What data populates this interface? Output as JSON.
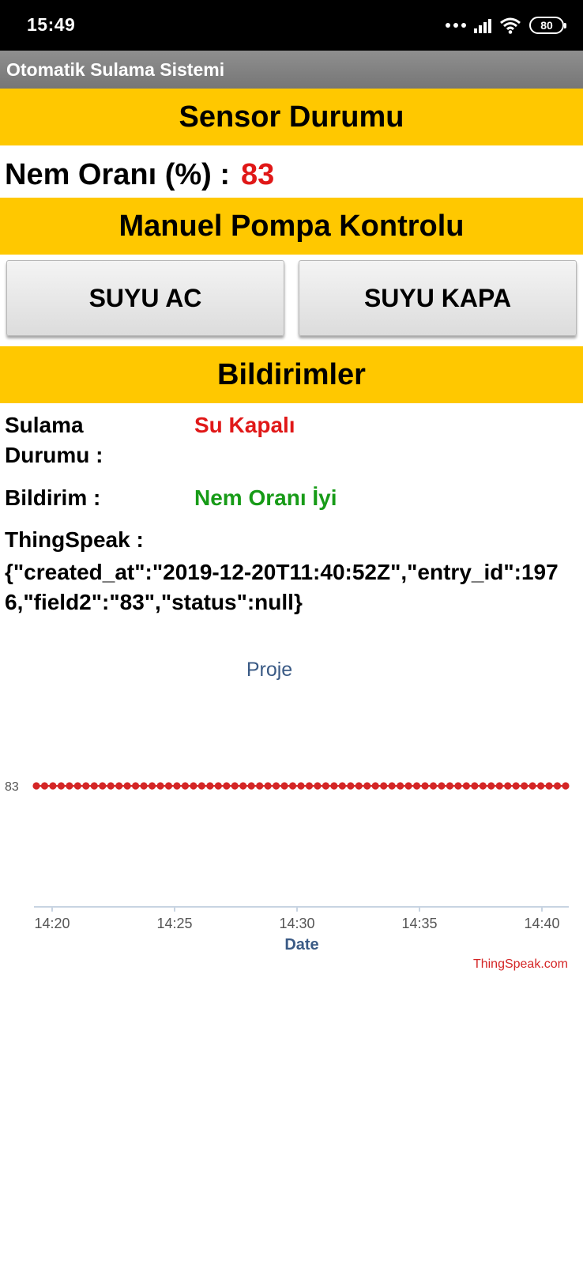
{
  "status_bar": {
    "time": "15:49",
    "battery": "80",
    "icons": [
      "more-dots-icon",
      "signal-icon",
      "wifi-icon",
      "battery-icon"
    ]
  },
  "app": {
    "title": "Otomatik Sulama Sistemi"
  },
  "sensor_section": {
    "header": "Sensor Durumu",
    "nem_label": "Nem Oranı (%) :",
    "nem_value": "83"
  },
  "pump_section": {
    "header": "Manuel Pompa Kontrolu",
    "open_button": "SUYU AC",
    "close_button": "SUYU KAPA"
  },
  "notifications": {
    "header": "Bildirimler",
    "irrigation_label": "Sulama Durumu :",
    "irrigation_value": "Su Kapalı",
    "notice_label": "Bildirim :",
    "notice_value": "Nem Oranı İyi",
    "thingspeak_label": "ThingSpeak :",
    "thingspeak_json": "{\"created_at\":\"2019-12-20T11:40:52Z\",\"entry_id\":1976,\"field2\":\"83\",\"status\":null}"
  },
  "colors": {
    "band": "#ffc800",
    "red_value": "#e01818",
    "green_value": "#179b17",
    "chart_point": "#d42626",
    "chart_title": "#3a5a85"
  },
  "chart_data": {
    "type": "line",
    "title": "Proje",
    "xlabel": "Date",
    "ylabel": "",
    "x_ticks": [
      "14:20",
      "14:25",
      "14:30",
      "14:35",
      "14:40"
    ],
    "y_ticks": [
      "83"
    ],
    "x_range_minutes": [
      "14:20",
      "14:41"
    ],
    "series": [
      {
        "values": [
          83,
          83,
          83,
          83,
          83,
          83,
          83,
          83,
          83,
          83,
          83,
          83,
          83,
          83,
          83,
          83,
          83,
          83,
          83,
          83,
          83,
          83,
          83,
          83,
          83,
          83,
          83,
          83,
          83,
          83,
          83,
          83,
          83,
          83,
          83,
          83,
          83,
          83,
          83,
          83,
          83,
          83,
          83,
          83,
          83,
          83,
          83,
          83,
          83,
          83,
          83,
          83,
          83,
          83,
          83,
          83,
          83,
          83,
          83,
          83,
          83,
          83,
          83,
          83,
          83
        ]
      }
    ],
    "credit": "ThingSpeak.com",
    "grid": false
  }
}
